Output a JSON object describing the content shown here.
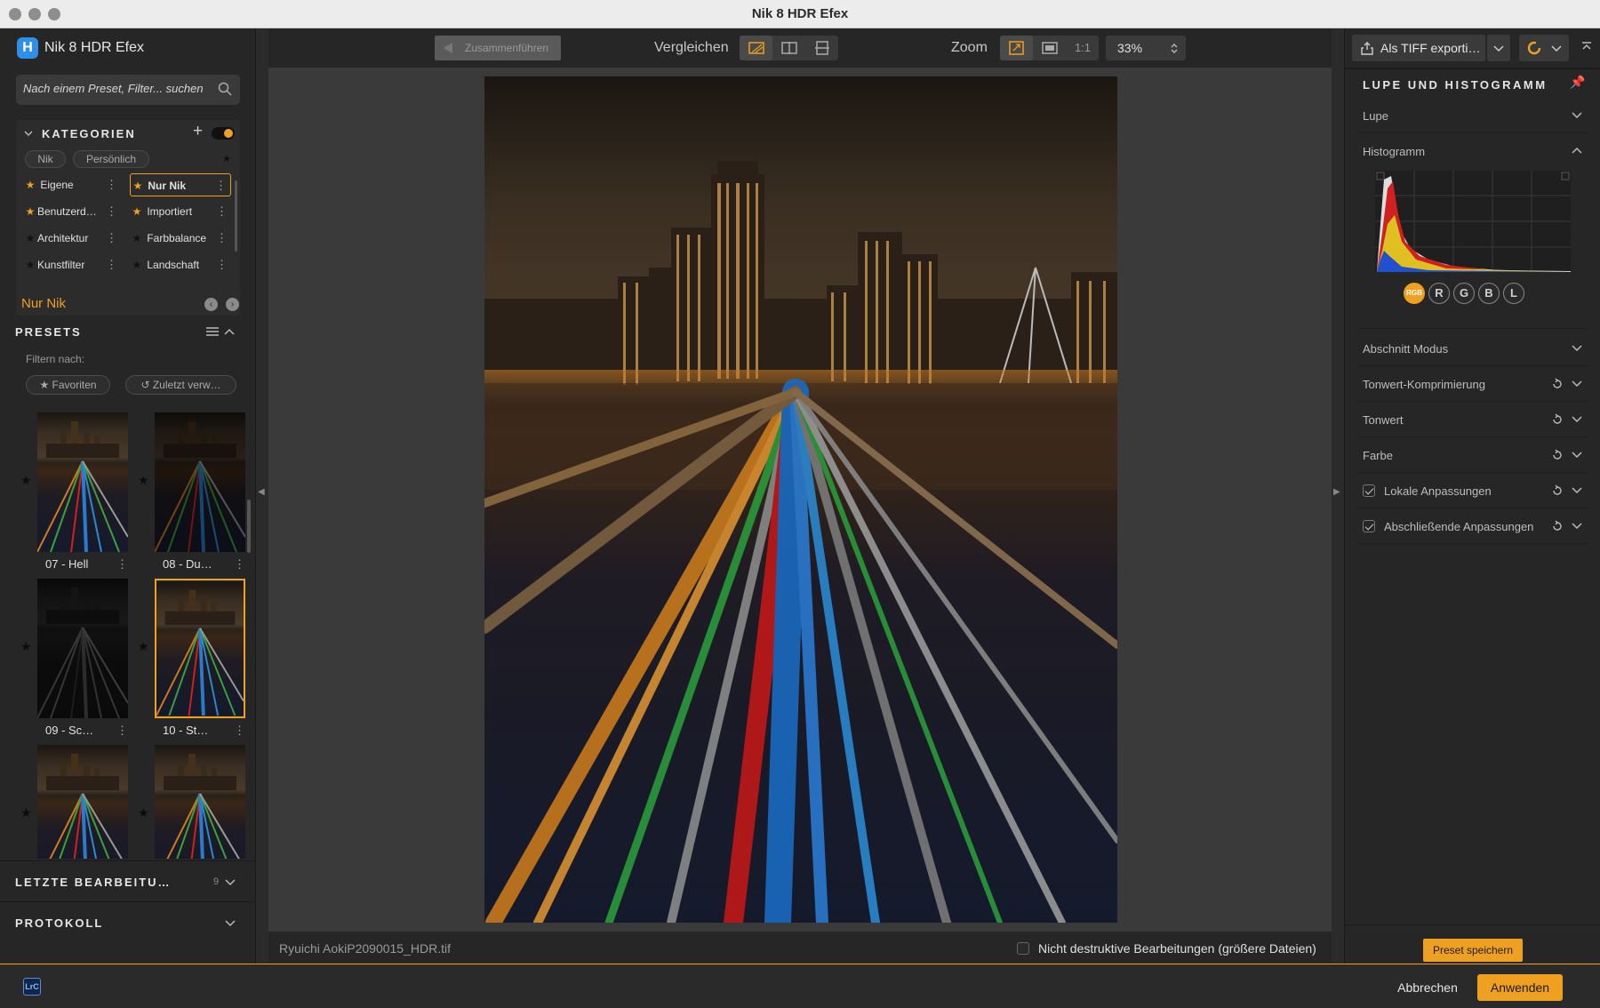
{
  "window": {
    "title": "Nik 8 HDR Efex"
  },
  "app": {
    "name": "Nik 8 HDR Efex",
    "logo_letter": "H"
  },
  "search": {
    "placeholder": "Nach einem Preset, Filter... suchen"
  },
  "categories": {
    "heading": "KATEGORIEN",
    "tabs": [
      "Nik",
      "Persönlich"
    ],
    "items": [
      {
        "label": "Eigene",
        "starred": true
      },
      {
        "label": "Nur Nik",
        "starred": true,
        "selected": true
      },
      {
        "label": "Benutzerd…",
        "starred": true
      },
      {
        "label": "Importiert",
        "starred": true
      },
      {
        "label": "Architektur",
        "starred": false
      },
      {
        "label": "Farbbalance",
        "starred": false
      },
      {
        "label": "Kunstfilter",
        "starred": false
      },
      {
        "label": "Landschaft",
        "starred": false
      }
    ]
  },
  "current_category": "Nur Nik",
  "presets": {
    "heading": "PRESETS",
    "filter_label": "Filtern nach:",
    "filters": [
      "Favoriten",
      "Zuletzt verw…"
    ],
    "items": [
      {
        "label": "07 - Hell",
        "selected": false
      },
      {
        "label": "08 - Du…",
        "selected": false
      },
      {
        "label": "09 - Sc…",
        "selected": false
      },
      {
        "label": "10 - St…",
        "selected": true
      },
      {
        "label": "",
        "selected": false
      },
      {
        "label": "",
        "selected": false
      }
    ]
  },
  "recent": {
    "heading": "LETZTE BEARBEITU…",
    "count": "9"
  },
  "history": {
    "heading": "PROTOKOLL"
  },
  "toolbar": {
    "merge_label": "Zusammenführen",
    "compare_label": "Vergleichen",
    "zoom_label": "Zoom",
    "zoom_one": "1:1",
    "zoom_value": "33%"
  },
  "status": {
    "file_name": "Ryuichi AokiP2090015_HDR.tif",
    "non_destructive_label": "Nicht destruktive Bearbeitungen (größere Dateien)"
  },
  "right": {
    "export_label": "Als TIFF exporti…",
    "panel_title": "LUPE UND HISTOGRAMM",
    "loupe_label": "Lupe",
    "histogram_label": "Histogramm",
    "channels": [
      "RGB",
      "R",
      "G",
      "B",
      "L"
    ],
    "sections": [
      {
        "label": "Abschnitt Modus",
        "reset": false,
        "checkbox": false
      },
      {
        "label": "Tonwert-Komprimierung",
        "reset": true,
        "checkbox": false
      },
      {
        "label": "Tonwert",
        "reset": true,
        "checkbox": false
      },
      {
        "label": "Farbe",
        "reset": true,
        "checkbox": false
      },
      {
        "label": "Lokale Anpassungen",
        "reset": true,
        "checkbox": true
      },
      {
        "label": "Abschließende Anpassungen",
        "reset": true,
        "checkbox": true
      }
    ],
    "save_preset_label": "Preset speichern"
  },
  "footer": {
    "lrc_badge": "LrC",
    "cancel_label": "Abbrechen",
    "apply_label": "Anwenden"
  },
  "colors": {
    "accent": "#f0a020",
    "panel": "#262626",
    "canvas": "#3a3a3a"
  }
}
